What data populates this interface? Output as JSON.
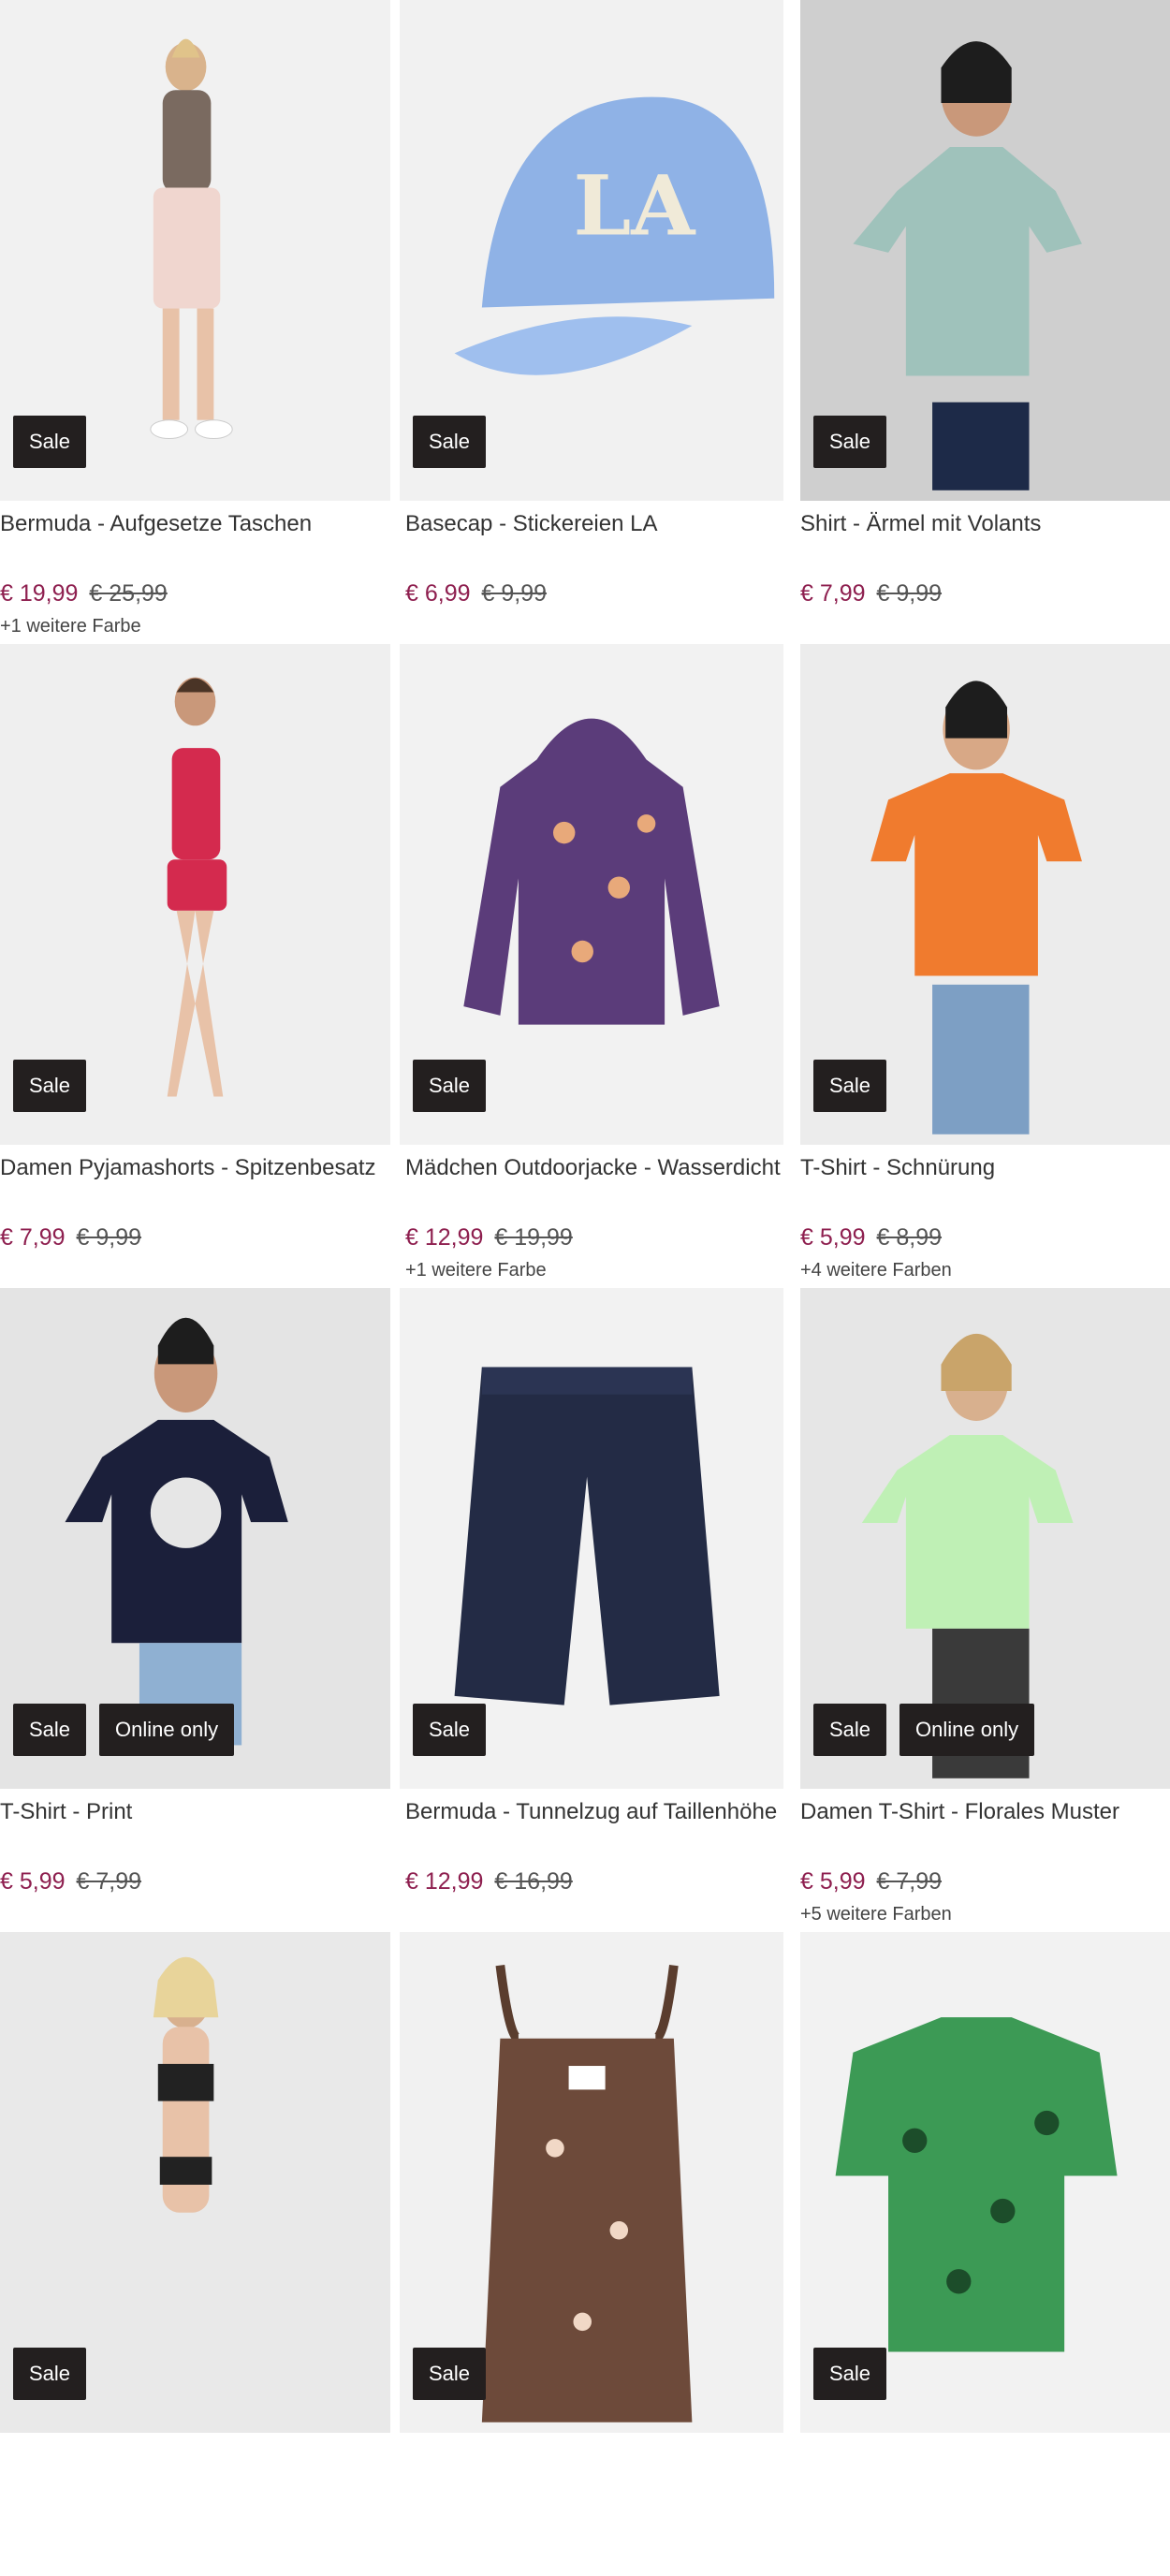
{
  "products": [
    {
      "title": "Bermuda - Aufgesetze Taschen",
      "price": "€ 19,99",
      "old_price": "€ 25,99",
      "colors": "+1 weitere Farbe",
      "badges": [
        "Sale"
      ],
      "bg": "#f1f1f1",
      "icon": "bermuda-photo"
    },
    {
      "title": "Basecap - Stickereien LA",
      "price": "€ 6,99",
      "old_price": "€ 9,99",
      "colors": "",
      "badges": [
        "Sale"
      ],
      "bg": "#f1f1f1",
      "icon": "basecap-photo"
    },
    {
      "title": "Shirt - Ärmel mit Volants",
      "price": "€ 7,99",
      "old_price": "€ 9,99",
      "colors": "",
      "badges": [
        "Sale"
      ],
      "bg": "#cfcfcf",
      "icon": "shirt-photo"
    },
    {
      "title": "Damen Pyjamashorts - Spitzenbesatz",
      "price": "€ 7,99",
      "old_price": "€ 9,99",
      "colors": "",
      "badges": [
        "Sale"
      ],
      "bg": "#efefef",
      "icon": "pyjama-photo"
    },
    {
      "title": "Mädchen Outdoorjacke - Wasserdicht",
      "price": "€ 12,99",
      "old_price": "€ 19,99",
      "colors": "+1 weitere Farbe",
      "badges": [
        "Sale"
      ],
      "bg": "#f2f2f2",
      "icon": "jacket-photo"
    },
    {
      "title": "T-Shirt - Schnürung",
      "price": "€ 5,99",
      "old_price": "€ 8,99",
      "colors": "+4 weitere Farben",
      "badges": [
        "Sale"
      ],
      "bg": "#ececec",
      "icon": "tshirt-orange-photo"
    },
    {
      "title": "T-Shirt - Print",
      "price": "€ 5,99",
      "old_price": "€ 7,99",
      "colors": "",
      "badges": [
        "Sale",
        "Online only"
      ],
      "bg": "#e4e4e4",
      "icon": "tshirt-print-photo"
    },
    {
      "title": "Bermuda - Tunnelzug auf Taillenhöhe",
      "price": "€ 12,99",
      "old_price": "€ 16,99",
      "colors": "",
      "badges": [
        "Sale"
      ],
      "bg": "#f2f2f2",
      "icon": "bermuda-navy-photo"
    },
    {
      "title": "Damen T-Shirt - Florales Muster",
      "price": "€ 5,99",
      "old_price": "€ 7,99",
      "colors": "+5 weitere Farben",
      "badges": [
        "Sale",
        "Online only"
      ],
      "bg": "#e6e6e6",
      "icon": "tshirt-floral-photo"
    },
    {
      "title": "",
      "price": "",
      "old_price": "",
      "colors": "",
      "badges": [
        "Sale"
      ],
      "bg": "#e9e9e9",
      "icon": "bikini-photo"
    },
    {
      "title": "",
      "price": "",
      "old_price": "",
      "colors": "",
      "badges": [
        "Sale"
      ],
      "bg": "#f1f1f1",
      "icon": "top-photo"
    },
    {
      "title": "",
      "price": "",
      "old_price": "",
      "colors": "",
      "badges": [
        "Sale"
      ],
      "bg": "#f2f2f2",
      "icon": "blouse-photo"
    }
  ]
}
